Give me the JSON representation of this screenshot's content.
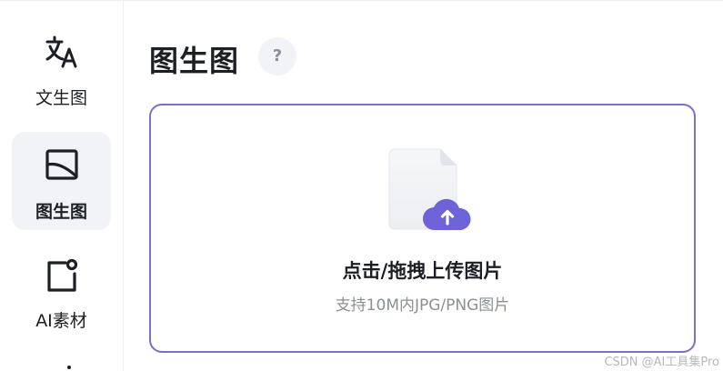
{
  "sidebar": {
    "items": [
      {
        "label": "文生图",
        "icon": "translate-icon",
        "active": false
      },
      {
        "label": "图生图",
        "icon": "image-frame-icon",
        "active": true
      },
      {
        "label": "AI素材",
        "icon": "material-icon",
        "active": false
      }
    ]
  },
  "header": {
    "title": "图生图",
    "help_label": "?"
  },
  "upload": {
    "title": "点击/拖拽上传图片",
    "hint": "支持10M内JPG/PNG图片",
    "icon": "upload-file-icon"
  },
  "watermark": "CSDN @AI工具集Pro",
  "colors": {
    "accent": "#6e62d8",
    "border_accent": "#7b6fc7",
    "active_bg": "#f1f3f6",
    "muted_text": "#8a8f99"
  }
}
